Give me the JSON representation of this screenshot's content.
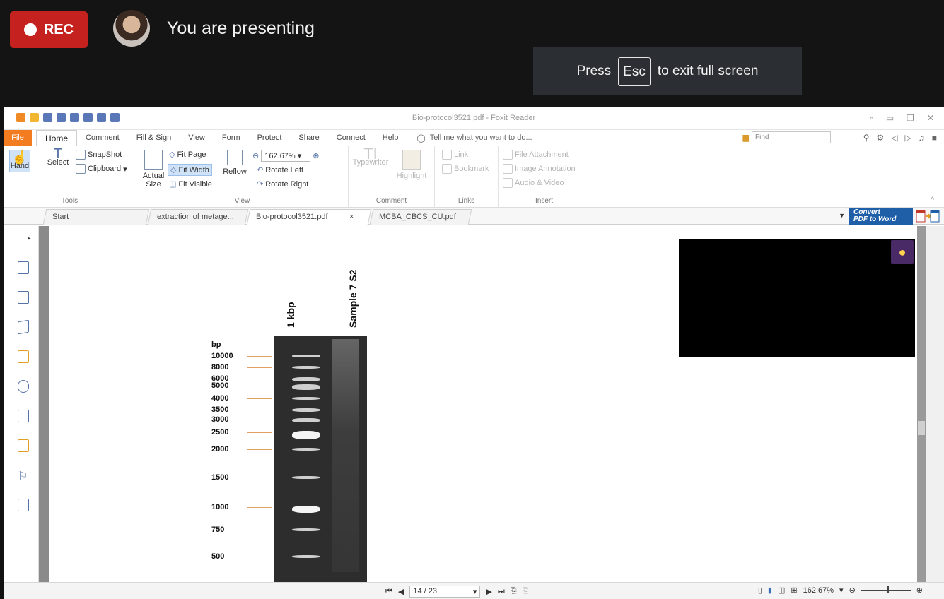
{
  "meet": {
    "rec_label": "REC",
    "presenting_text": "You are presenting",
    "esc_press": "Press",
    "esc_key": "Esc",
    "esc_rest": "to exit full screen"
  },
  "window": {
    "title": "Bio-protocol3521.pdf - Foxit Reader"
  },
  "menu": {
    "file": "File",
    "tabs": [
      "Home",
      "Comment",
      "Fill & Sign",
      "View",
      "Form",
      "Protect",
      "Share",
      "Connect",
      "Help"
    ],
    "tell_me": "Tell me what you want to do...",
    "find_placeholder": "Find"
  },
  "ribbon": {
    "hand": "Hand",
    "select": "Select",
    "snapshot": "SnapShot",
    "clipboard": "Clipboard",
    "tools_group": "Tools",
    "actual_size": "Actual Size",
    "fit_page": "Fit Page",
    "fit_width": "Fit Width",
    "fit_visible": "Fit Visible",
    "reflow": "Reflow",
    "zoom_value": "162.67%",
    "rotate_left": "Rotate Left",
    "rotate_right": "Rotate Right",
    "view_group": "View",
    "typewriter": "Typewriter",
    "highlight": "Highlight",
    "comment_group": "Comment",
    "link": "Link",
    "bookmark": "Bookmark",
    "links_group": "Links",
    "file_attachment": "File Attachment",
    "image_annotation": "Image Annotation",
    "audio_video": "Audio & Video",
    "insert_group": "Insert"
  },
  "doc_tabs": [
    "Start",
    "extraction of metage...",
    "Bio-protocol3521.pdf",
    "MCBA_CBCS_CU.pdf"
  ],
  "convert": {
    "line1": "Convert",
    "line2": "PDF to Word"
  },
  "gel": {
    "lane1": "1 kbp",
    "lane2": "Sample 7 S2",
    "unit": "bp",
    "ladder": [
      "10000",
      "8000",
      "6000",
      "5000",
      "4000",
      "3500",
      "3000",
      "2500",
      "2000",
      "1500",
      "1000",
      "750",
      "500"
    ]
  },
  "status": {
    "page": "14 / 23",
    "zoom": "162.67%"
  },
  "colors": {
    "rec_red": "#c5221f",
    "foxit_orange": "#f47c20",
    "convert_blue": "#1e5fa8",
    "tick_orange": "#e0a060"
  }
}
